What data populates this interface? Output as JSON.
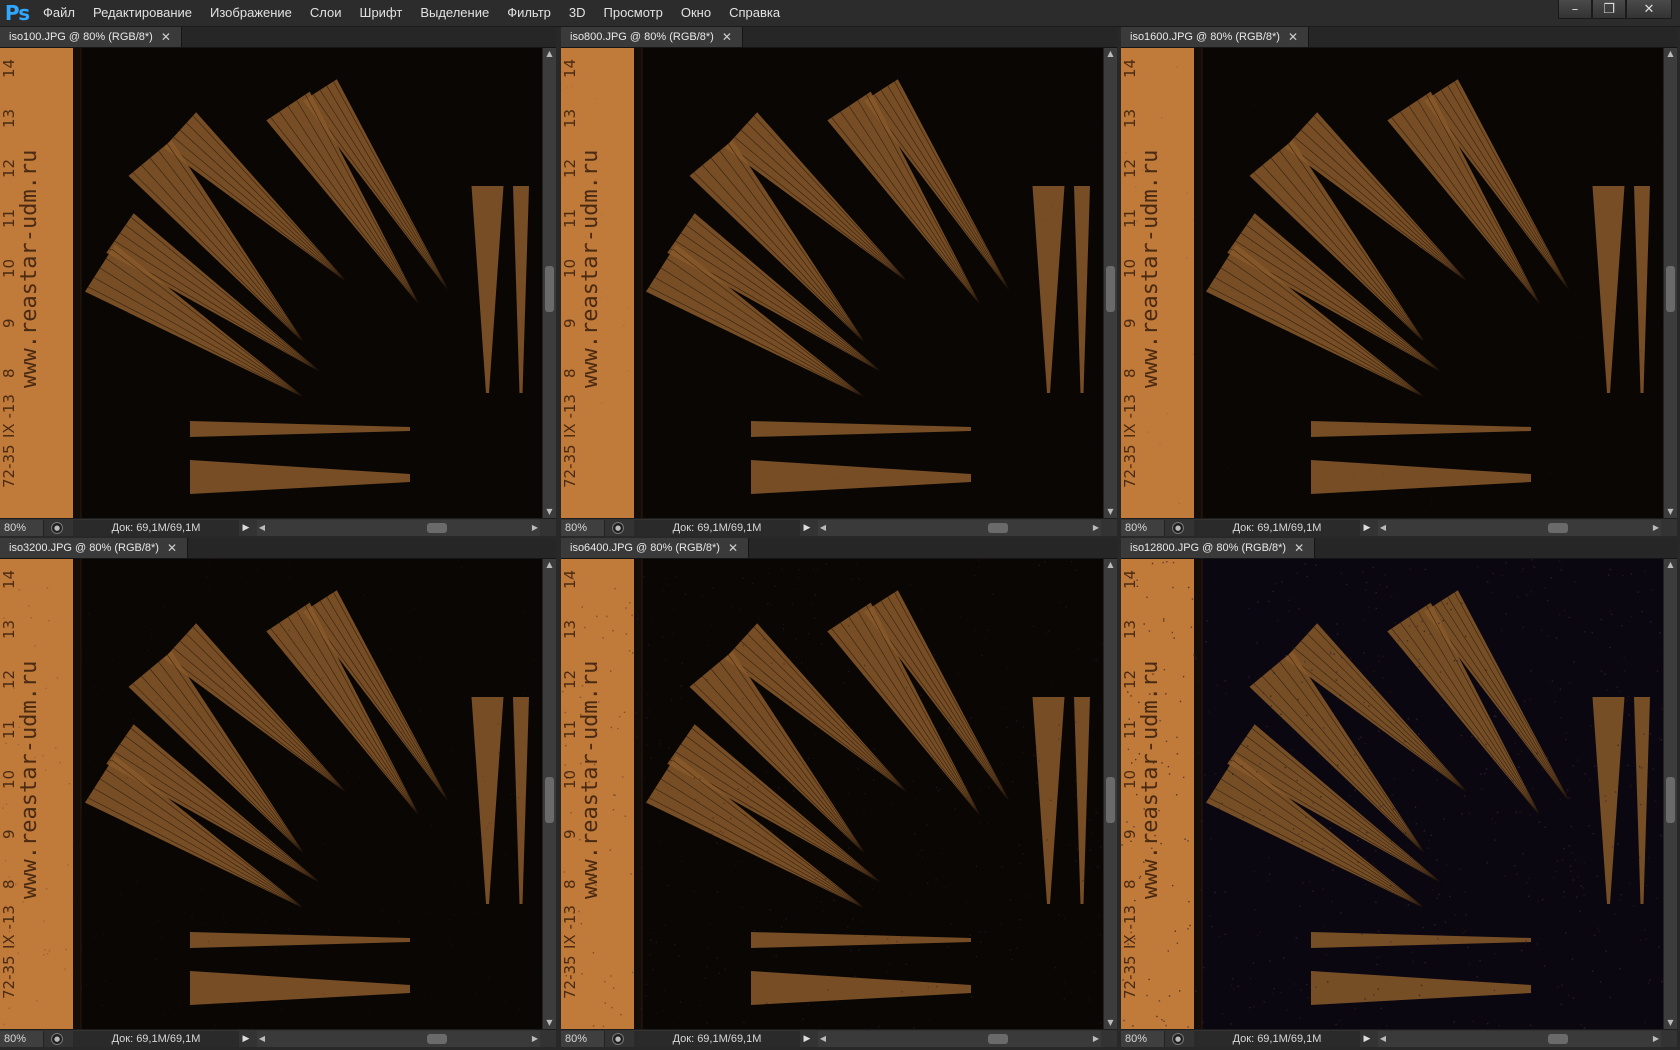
{
  "app": {
    "logo": "Ps",
    "menu": [
      "Файл",
      "Редактирование",
      "Изображение",
      "Слои",
      "Шрифт",
      "Выделение",
      "Фильтр",
      "3D",
      "Просмотр",
      "Окно",
      "Справка"
    ],
    "window_controls": [
      "–",
      "❐",
      "✕"
    ]
  },
  "documents": [
    {
      "tab": "iso100.JPG @ 80% (RGB/8*)",
      "zoom": "80%",
      "doc_info": "Док: 69,1M/69,1M",
      "noise": 0.0
    },
    {
      "tab": "iso800.JPG @ 80% (RGB/8*)",
      "zoom": "80%",
      "doc_info": "Док: 69,1M/69,1M",
      "noise": 0.1
    },
    {
      "tab": "iso1600.JPG @ 80% (RGB/8*)",
      "zoom": "80%",
      "doc_info": "Док: 69,1M/69,1M",
      "noise": 0.15
    },
    {
      "tab": "iso3200.JPG @ 80% (RGB/8*)",
      "zoom": "80%",
      "doc_info": "Док: 69,1M/69,1M",
      "noise": 0.25
    },
    {
      "tab": "iso6400.JPG @ 80% (RGB/8*)",
      "zoom": "80%",
      "doc_info": "Док: 69,1M/69,1M",
      "noise": 0.45
    },
    {
      "tab": "iso12800.JPG @ 80% (RGB/8*)",
      "zoom": "80%",
      "doc_info": "Док: 69,1M/69,1M",
      "noise": 0.7
    }
  ],
  "photo": {
    "ruler_text": "www.reastar-udm.ru",
    "ruler_marks": [
      "14",
      "13",
      "12",
      "11",
      "10",
      "9",
      "8",
      "IX -13",
      "72-35"
    ],
    "colors": {
      "ruler": "#c07a3a",
      "wedge": "#8a5a2a",
      "background": "#0a0604"
    }
  }
}
